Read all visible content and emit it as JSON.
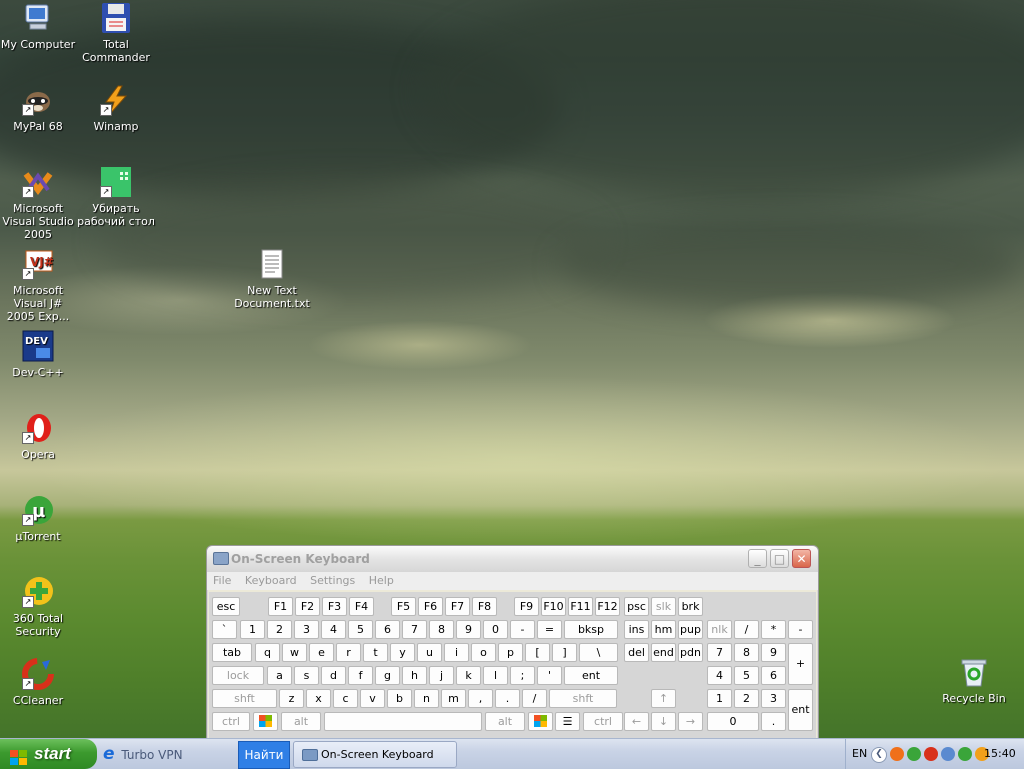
{
  "desktop": {
    "icons": [
      {
        "label": "My Computer",
        "icon": "my-computer-icon",
        "shortcut": false
      },
      {
        "label": "Total Commander",
        "icon": "floppy-disk-icon",
        "shortcut": false
      },
      {
        "label": "MyPal 68",
        "icon": "raccoon-icon",
        "shortcut": true
      },
      {
        "label": "Winamp",
        "icon": "lightning-bolt-icon",
        "shortcut": true
      },
      {
        "label": "Microsoft Visual Studio 2005",
        "icon": "visual-studio-icon",
        "shortcut": true
      },
      {
        "label": "Убирать рабочий стол",
        "icon": "green-grid-icon",
        "shortcut": true
      },
      {
        "label": "Microsoft Visual J# 2005 Exp...",
        "icon": "vj-icon",
        "shortcut": true
      },
      {
        "label": "New Text Document.txt",
        "icon": "text-document-icon",
        "shortcut": false
      },
      {
        "label": "Dev-C++",
        "icon": "dev-cpp-icon",
        "shortcut": false
      },
      {
        "label": "Opera",
        "icon": "opera-icon",
        "shortcut": true
      },
      {
        "label": "µTorrent",
        "icon": "utorrent-icon",
        "shortcut": true
      },
      {
        "label": "360 Total Security",
        "icon": "plus-shield-icon",
        "shortcut": true
      },
      {
        "label": "CCleaner",
        "icon": "ccleaner-icon",
        "shortcut": true
      },
      {
        "label": "Recycle Bin",
        "icon": "recycle-bin-icon",
        "shortcut": false
      }
    ]
  },
  "osk": {
    "title": "On-Screen Keyboard",
    "menu": [
      "File",
      "Keyboard",
      "Settings",
      "Help"
    ],
    "keys": {
      "row1": [
        "esc",
        "F1",
        "F2",
        "F3",
        "F4",
        "F5",
        "F6",
        "F7",
        "F8",
        "F9",
        "F10",
        "F11",
        "F12",
        "psc",
        "slk",
        "brk"
      ],
      "row2": [
        "`",
        "1",
        "2",
        "3",
        "4",
        "5",
        "6",
        "7",
        "8",
        "9",
        "0",
        "-",
        "=",
        "bksp",
        "ins",
        "hm",
        "pup",
        "nlk",
        "/",
        "*",
        "-"
      ],
      "row3": [
        "tab",
        "q",
        "w",
        "e",
        "r",
        "t",
        "y",
        "u",
        "i",
        "o",
        "p",
        "[",
        "]",
        "\\",
        "del",
        "end",
        "pdn",
        "7",
        "8",
        "9",
        "+"
      ],
      "row4": [
        "lock",
        "a",
        "s",
        "d",
        "f",
        "g",
        "h",
        "j",
        "k",
        "l",
        ";",
        "'",
        "ent",
        "4",
        "5",
        "6"
      ],
      "row5": [
        "shft",
        "z",
        "x",
        "c",
        "v",
        "b",
        "n",
        "m",
        ",",
        ".",
        "/",
        "shft",
        "↑",
        "1",
        "2",
        "3",
        "ent"
      ],
      "row6": [
        "ctrl",
        "alt",
        "alt",
        "ctrl",
        "←",
        "↓",
        "→",
        "0",
        "."
      ]
    }
  },
  "taskbar": {
    "start_label": "start",
    "quicklaunch_label": "Turbo VPN",
    "find_label": "Найти",
    "task_label": "On-Screen Keyboard",
    "language": "EN",
    "clock": "15:40"
  },
  "colors": {
    "start_green": "#3c9a2e",
    "find_blue": "#2f7fe6",
    "osk_title_disabled": "#a0a0a0"
  }
}
